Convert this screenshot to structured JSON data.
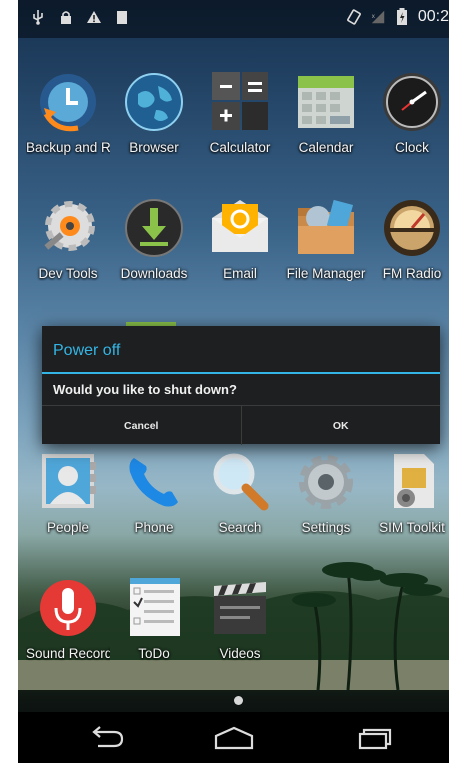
{
  "status_bar": {
    "left_icons": [
      "usb-icon",
      "lock-icon",
      "warning-icon",
      "sd-card-icon"
    ],
    "right_icons": [
      "rotate-icon",
      "signal-icon",
      "battery-icon"
    ],
    "clock": "00:2"
  },
  "apps": [
    {
      "label": "Backup and Re",
      "icon": "backup-icon"
    },
    {
      "label": "Browser",
      "icon": "browser-icon"
    },
    {
      "label": "Calculator",
      "icon": "calculator-icon"
    },
    {
      "label": "Calendar",
      "icon": "calendar-icon"
    },
    {
      "label": "Clock",
      "icon": "clock-icon"
    },
    {
      "label": "Dev Tools",
      "icon": "dev-tools-icon"
    },
    {
      "label": "Downloads",
      "icon": "downloads-icon"
    },
    {
      "label": "Email",
      "icon": "email-icon"
    },
    {
      "label": "File Manager",
      "icon": "file-manager-icon"
    },
    {
      "label": "FM Radio",
      "icon": "fm-radio-icon"
    },
    {
      "label": "People",
      "icon": "people-icon"
    },
    {
      "label": "Phone",
      "icon": "phone-icon"
    },
    {
      "label": "Search",
      "icon": "search-icon"
    },
    {
      "label": "Settings",
      "icon": "settings-icon"
    },
    {
      "label": "SIM Toolkit",
      "icon": "sim-toolkit-icon"
    },
    {
      "label": "Sound Recorde",
      "icon": "sound-recorder-icon"
    },
    {
      "label": "ToDo",
      "icon": "todo-icon"
    },
    {
      "label": "Videos",
      "icon": "videos-icon"
    }
  ],
  "dialog": {
    "title": "Power off",
    "message": "Would you like to shut down?",
    "cancel_label": "Cancel",
    "ok_label": "OK",
    "accent_color": "#33b5e5"
  },
  "nav_bar": {
    "icons": [
      "back-icon",
      "home-icon",
      "recent-apps-icon"
    ]
  }
}
